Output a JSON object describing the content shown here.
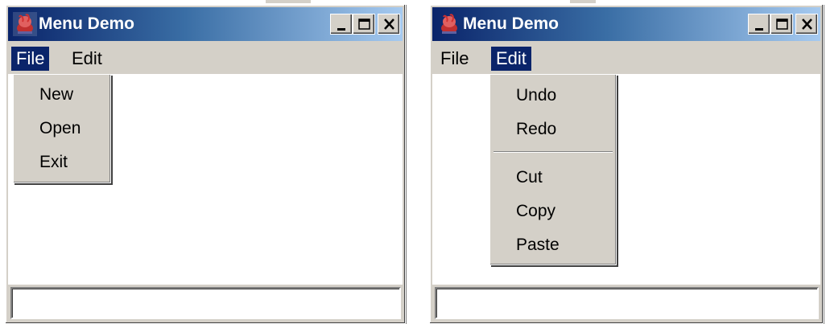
{
  "windows": [
    {
      "title": "Menu Demo",
      "menubar": [
        {
          "label": "File",
          "active": true
        },
        {
          "label": "Edit",
          "active": false
        }
      ],
      "popup": {
        "items": [
          "New",
          "Open",
          "Exit"
        ]
      }
    },
    {
      "title": "Menu Demo",
      "menubar": [
        {
          "label": "File",
          "active": false
        },
        {
          "label": "Edit",
          "active": true
        }
      ],
      "popup": {
        "groups": [
          [
            "Undo",
            "Redo"
          ],
          [
            "Cut",
            "Copy",
            "Paste"
          ]
        ]
      }
    }
  ],
  "colors": {
    "face": "#d4d0c8",
    "titlebar_start": "#0a246a",
    "titlebar_end": "#a6caf0",
    "selected_menu": "#0a246a"
  },
  "icons": {
    "app": "java-cup-icon",
    "minimize": "minimize-icon",
    "maximize": "maximize-icon",
    "close": "close-icon"
  }
}
